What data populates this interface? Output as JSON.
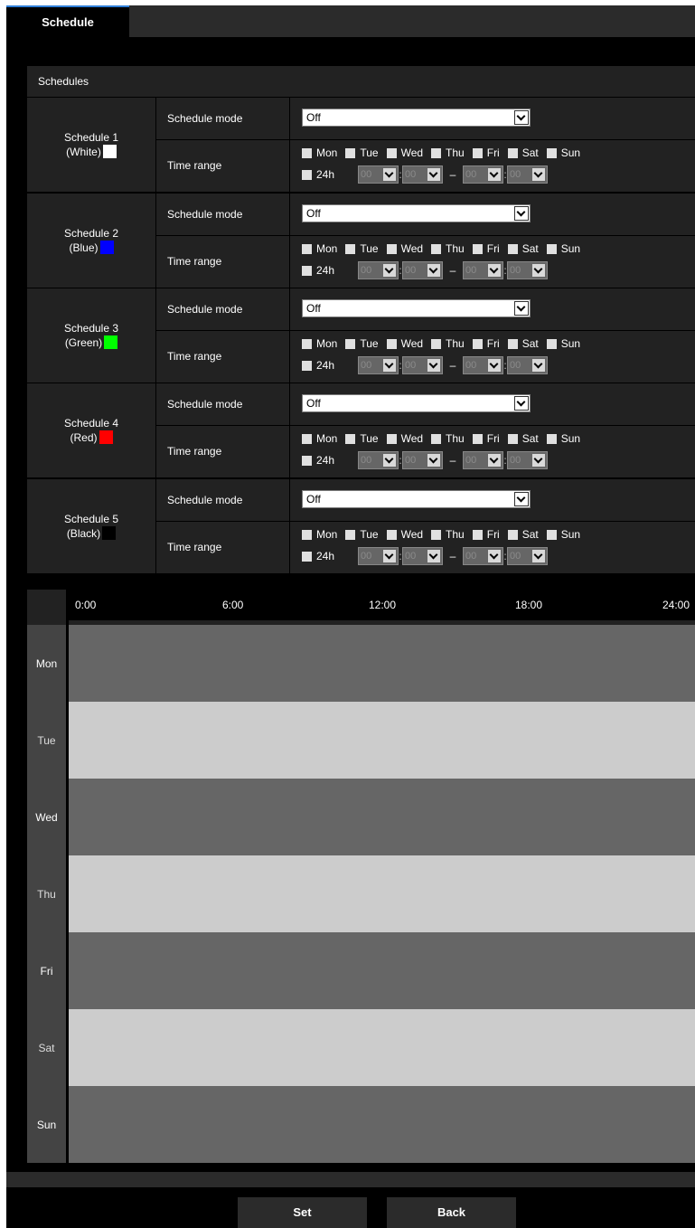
{
  "tabs": [
    {
      "label": "Schedule"
    }
  ],
  "header": {
    "title": "Schedules"
  },
  "labels": {
    "schedule_mode": "Schedule mode",
    "time_range": "Time range",
    "h24": "24h",
    "colon": ":",
    "dash": "–"
  },
  "days": [
    "Mon",
    "Tue",
    "Wed",
    "Thu",
    "Fri",
    "Sat",
    "Sun"
  ],
  "time_placeholder": "00",
  "schedules": [
    {
      "name": "Schedule 1",
      "color_name": "(White)",
      "color": "#ffffff",
      "mode": "Off"
    },
    {
      "name": "Schedule 2",
      "color_name": "(Blue)",
      "color": "#0000ff",
      "mode": "Off"
    },
    {
      "name": "Schedule 3",
      "color_name": "(Green)",
      "color": "#00ff00",
      "mode": "Off"
    },
    {
      "name": "Schedule 4",
      "color_name": "(Red)",
      "color": "#ff0000",
      "mode": "Off"
    },
    {
      "name": "Schedule 5",
      "color_name": "(Black)",
      "color": "#000000",
      "mode": "Off"
    }
  ],
  "timeline": {
    "ticks": [
      "0:00",
      "6:00",
      "12:00",
      "18:00",
      "24:00"
    ],
    "row_colors": [
      "#666666",
      "#cccccc"
    ]
  },
  "buttons": {
    "set": "Set",
    "back": "Back"
  }
}
